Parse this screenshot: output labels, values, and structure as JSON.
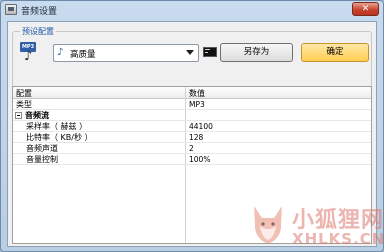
{
  "window": {
    "title": "音频设置",
    "close_symbol": "✕"
  },
  "preset": {
    "group_label": "预设配置",
    "selected": "高质量",
    "save_as_label": "另存为",
    "ok_label": "确定"
  },
  "grid": {
    "headers": [
      "配置",
      "数值"
    ],
    "rows": [
      {
        "label": "类型",
        "value": "MP3"
      },
      {
        "label": "音频流",
        "category": true
      },
      {
        "label": "采样率（ 赫兹 ）",
        "value": "44100"
      },
      {
        "label": "比特率（ KB/秒 ）",
        "value": "128"
      },
      {
        "label": "音频声道",
        "value": "2"
      },
      {
        "label": "音量控制",
        "value": "100%"
      }
    ]
  },
  "watermark": {
    "cn": "小狐狸网",
    "en": "XHLKS.CN"
  },
  "colors": {
    "group_label": "#1a56a6",
    "ok_button": "#ffcf52",
    "title_bar": "#c9dbee",
    "watermark": "#dc786e"
  }
}
